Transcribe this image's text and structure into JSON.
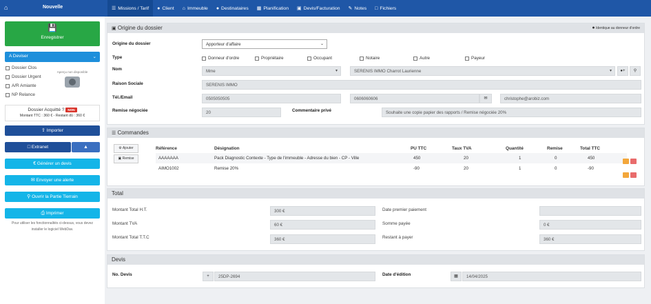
{
  "topbar": {
    "home_icon": "home-icon",
    "new_label": "Nouvelle",
    "tabs": [
      {
        "label": "Missions / Tarif",
        "icon": "list-icon",
        "active": true
      },
      {
        "label": "Client",
        "icon": "user-icon"
      },
      {
        "label": "Immeuble",
        "icon": "home-icon"
      },
      {
        "label": "Destinataires",
        "icon": "users-icon"
      },
      {
        "label": "Planification",
        "icon": "calendar-icon"
      },
      {
        "label": "Devis/Facturation",
        "icon": "money-icon"
      },
      {
        "label": "Notes",
        "icon": "edit-icon"
      },
      {
        "label": "Fichiers",
        "icon": "file-icon"
      }
    ]
  },
  "sidebar": {
    "save_label": "Enregistrer",
    "status_select": "A Deviser",
    "checkboxes": [
      "Dossier Clos",
      "Dossier Urgent",
      "A/R Amiante",
      "NP Relance"
    ],
    "photo_caption": "Aperçu non disponible",
    "acquitte_label": "Dossier Acquitté ?",
    "acquitte_badge": "NON",
    "montant_line": "Montant TTC : 360 € - Restant dû : 360 €",
    "import_label": "Importer",
    "extranet_label": "Extranet",
    "generer_label": "Générer un devis",
    "alerte_label": "Envoyer une alerte",
    "partie_label": "Ouvrir la Partie Tierrain",
    "imprimer_label": "Imprimer",
    "note_line1": "Pour utiliser les fonctionnalités ci-dessus, vous devez",
    "note_line2": "installer le logiciel WebDav."
  },
  "origine": {
    "title": "Origine du dossier",
    "identique": "Identique au donneur d'ordre",
    "origine_label": "Origine du dossier",
    "origine_value": "Apporteur d'affaire",
    "type_label": "Type",
    "types": [
      "Donneur d'ordre",
      "Propriétaire",
      "Occupant",
      "Notaire",
      "Autre",
      "Payeur"
    ],
    "nom_label": "Nom",
    "civilite": "Mme",
    "nom_value": "SERENIS IMMO Charrot Laurienne",
    "raison_label": "Raison Sociale",
    "raison_value": "SERENIS IMMO",
    "tel_label": "Tél./Email",
    "tel1": "0505050505",
    "tel2": "0606060606",
    "email": "christophe@arobiz.com",
    "remise_label": "Remise négociée",
    "remise_value": "20",
    "commentaire_label": "Commentaire privé",
    "commentaire_value": "Souhaite une copie papier des rapports / Remise négociée 20%"
  },
  "commandes": {
    "title": "Commandes",
    "ajouter": "Ajouter",
    "remise": "Remise",
    "headers": [
      "Référence",
      "Désignation",
      "PU TTC",
      "Taux TVA",
      "Quantité",
      "Remise",
      "Total TTC"
    ],
    "rows": [
      {
        "ref": "AAAAAAA",
        "designation": "Pack Diagnostic Contexte - Type de l'immeuble - Adresse du bien - CP - Ville",
        "pu": "450",
        "tva": "20",
        "qte": "1",
        "remise": "0",
        "total": "450"
      },
      {
        "ref": "AIMO1002",
        "designation": "Remise 20%",
        "pu": "-90",
        "tva": "20",
        "qte": "1",
        "remise": "0",
        "total": "-90"
      }
    ]
  },
  "total": {
    "title": "Total",
    "ht_label": "Montant Total H.T.",
    "ht_value": "300 €",
    "tva_label": "Montant TVA",
    "tva_value": "60 €",
    "ttc_label": "Montant Total T.T.C",
    "ttc_value": "360 €",
    "date_label": "Date premier paiement",
    "somme_label": "Somme payée",
    "somme_value": "0 €",
    "restant_label": "Restant à payer",
    "restant_value": "360 €"
  },
  "devis": {
    "title": "Devis",
    "no_label": "No. Devis",
    "no_value": "25DP-2694",
    "date_label": "Date d'édition",
    "date_value": "14/04/2025"
  }
}
